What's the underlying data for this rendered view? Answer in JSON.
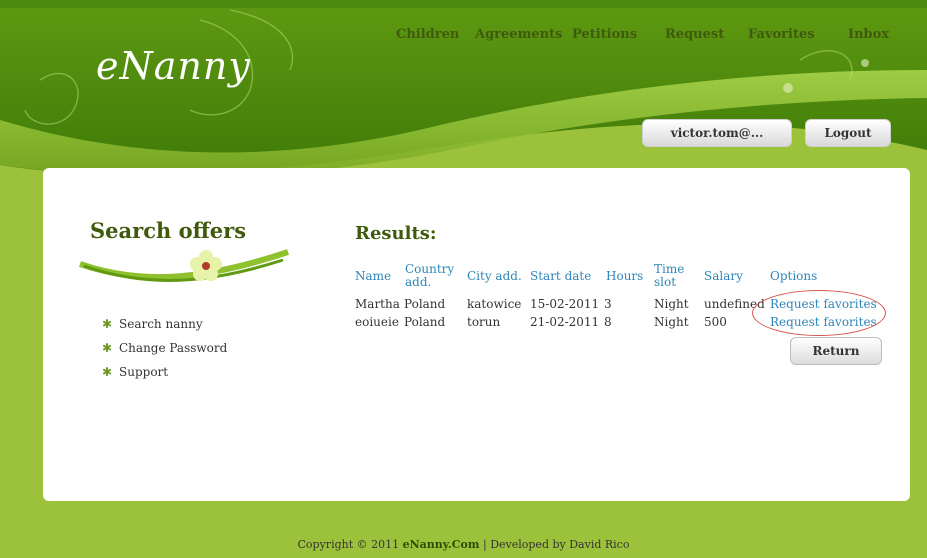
{
  "app": {
    "logo": "eNanny"
  },
  "nav": [
    "Children",
    "Agreements",
    "Petitions",
    "Request",
    "Favorites",
    "Inbox"
  ],
  "user": {
    "email": "victor.tom@...",
    "logout": "Logout"
  },
  "sidebar": {
    "title": "Search offers",
    "items": [
      "Search nanny",
      "Change Password",
      "Support"
    ]
  },
  "results": {
    "title": "Results:",
    "columns": [
      [
        "Name",
        ""
      ],
      [
        "Country",
        "add."
      ],
      [
        "City add.",
        ""
      ],
      [
        "Start date",
        ""
      ],
      [
        "Hours",
        ""
      ],
      [
        "Time",
        "slot"
      ],
      [
        "Salary",
        ""
      ],
      [
        "Options",
        ""
      ]
    ],
    "rows": [
      [
        "Martha",
        "Poland",
        "katowice",
        "15-02-2011",
        "3",
        "Night",
        "undefined",
        "Request favorites"
      ],
      [
        "eoiueie",
        "Poland",
        "torun",
        "21-02-2011",
        "8",
        "Night",
        "500",
        "Request favorites"
      ]
    ],
    "return_label": "Return"
  },
  "footer": {
    "prefix": "Copyright © 2011 ",
    "brand": "eNanny.Com",
    "suffix": " | Developed by David Rico"
  },
  "colors": {
    "accent": "#3f5a0c",
    "background": "#9cc13a",
    "link": "#2e86b8",
    "highlight": "#d9534f"
  }
}
